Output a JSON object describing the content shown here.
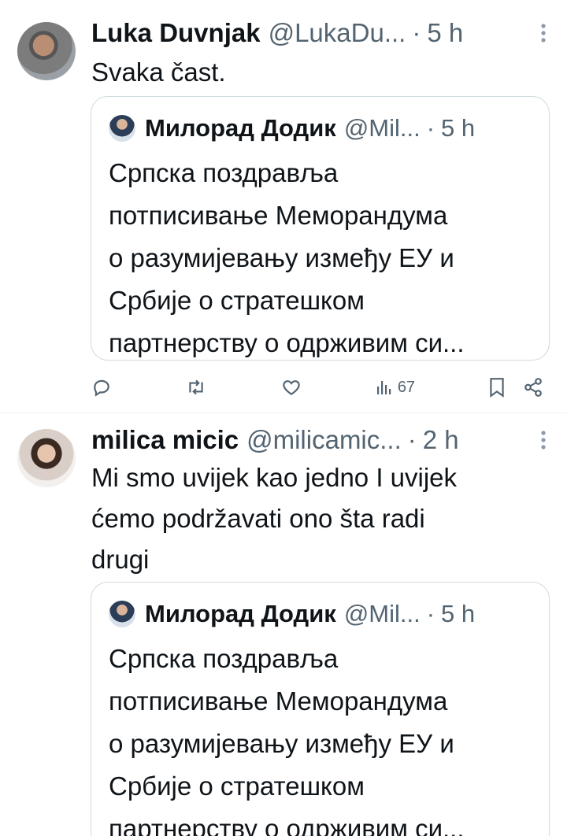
{
  "tweets": [
    {
      "author_name": "Luka Duvnjak",
      "author_handle": "@LukaDu...",
      "time": "5 h",
      "text": "Svaka čast.",
      "quote": {
        "author_name": "Милорад Додик",
        "author_handle": "@Mil...",
        "time": "5 h",
        "text_lines": [
          "Српска поздравља",
          "потписивање Меморандума",
          "о разумијевању између ЕУ и",
          "Србије о стратешком",
          "партнерству о одрживим си..."
        ]
      },
      "actions": {
        "views_count": "67"
      }
    },
    {
      "author_name": "milica micic",
      "author_handle": "@milicamic...",
      "time": "2 h",
      "text_lines": [
        "Mi smo uvijek kao jedno I uvijek",
        "ćemo podržavati ono šta radi",
        "drugi"
      ],
      "quote": {
        "author_name": "Милорад Додик",
        "author_handle": "@Mil...",
        "time": "5 h",
        "text_lines": [
          "Српска поздравља",
          "потписивање Меморандума",
          "о разумијевању између ЕУ и",
          "Србије о стратешком",
          "партнерству о одрживим си..."
        ]
      }
    }
  ],
  "separator": "·",
  "icons": {
    "more": "more-vertical-icon",
    "reply": "reply-icon",
    "retweet": "retweet-icon",
    "like": "heart-icon",
    "views": "views-icon",
    "bookmark": "bookmark-icon",
    "share": "share-icon"
  },
  "colors": {
    "text": "#0f1419",
    "secondary": "#536471",
    "border": "#cfd9de"
  }
}
